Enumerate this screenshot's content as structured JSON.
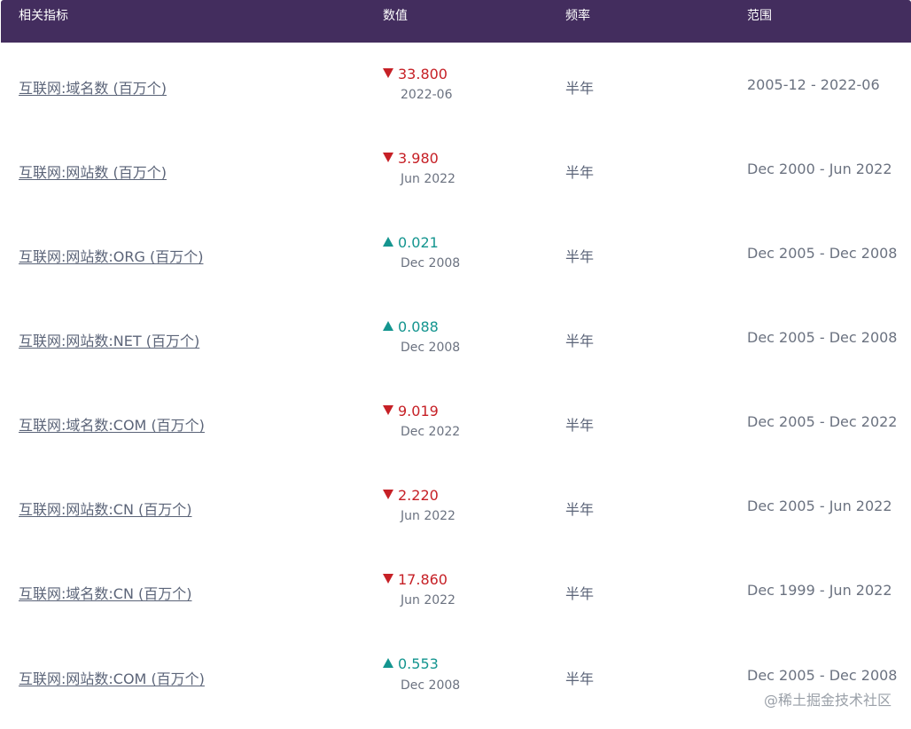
{
  "header": {
    "col_indicator": "相关指标",
    "col_value": "数值",
    "col_frequency": "频率",
    "col_range": "范围"
  },
  "colors": {
    "header_bg": "#432d5e",
    "down": "#c62026",
    "up": "#14958f"
  },
  "rows": [
    {
      "name": "互联网:域名数 (百万个)",
      "direction": "down",
      "value": "33.800",
      "date": "2022-06",
      "frequency": "半年",
      "range": "2005-12 - 2022-06"
    },
    {
      "name": "互联网:网站数 (百万个)",
      "direction": "down",
      "value": "3.980",
      "date": "Jun 2022",
      "frequency": "半年",
      "range": "Dec 2000 - Jun 2022"
    },
    {
      "name": "互联网:网站数:ORG (百万个)",
      "direction": "up",
      "value": "0.021",
      "date": "Dec 2008",
      "frequency": "半年",
      "range": "Dec 2005 - Dec 2008"
    },
    {
      "name": "互联网:网站数:NET (百万个)",
      "direction": "up",
      "value": "0.088",
      "date": "Dec 2008",
      "frequency": "半年",
      "range": "Dec 2005 - Dec 2008"
    },
    {
      "name": "互联网:域名数:COM (百万个)",
      "direction": "down",
      "value": "9.019",
      "date": "Dec 2022",
      "frequency": "半年",
      "range": "Dec 2005 - Dec 2022"
    },
    {
      "name": "互联网:网站数:CN (百万个)",
      "direction": "down",
      "value": "2.220",
      "date": "Jun 2022",
      "frequency": "半年",
      "range": "Dec 2005 - Jun 2022"
    },
    {
      "name": "互联网:域名数:CN (百万个)",
      "direction": "down",
      "value": "17.860",
      "date": "Jun 2022",
      "frequency": "半年",
      "range": "Dec 1999 - Jun 2022"
    },
    {
      "name": "互联网:网站数:COM (百万个)",
      "direction": "up",
      "value": "0.553",
      "date": "Dec 2008",
      "frequency": "半年",
      "range": "Dec 2005 - Dec 2008"
    }
  ],
  "watermark": "@稀土掘金技术社区"
}
